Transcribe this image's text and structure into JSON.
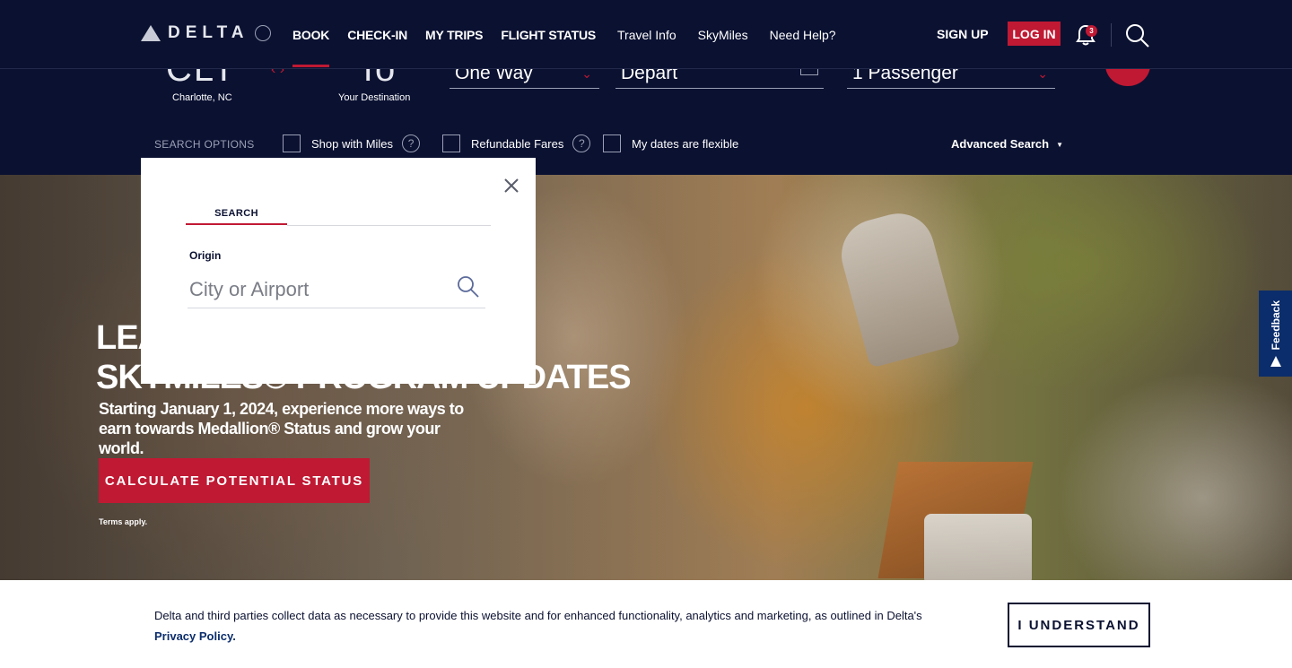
{
  "brand": {
    "name": "DELTA"
  },
  "nav": {
    "primary": [
      "BOOK",
      "CHECK-IN",
      "MY TRIPS",
      "FLIGHT STATUS"
    ],
    "secondary": [
      "Travel Info",
      "SkyMiles",
      "Need Help?"
    ],
    "sign_up": "SIGN UP",
    "log_in": "LOG IN",
    "notification_count": "3"
  },
  "booking": {
    "from_code": "CLT",
    "from_city": "Charlotte, NC",
    "to_code": "To",
    "to_label": "Your Destination",
    "trip_type": "One Way",
    "depart": "Depart",
    "passengers": "1 Passenger",
    "search_options_label": "SEARCH OPTIONS",
    "options": [
      "Shop with Miles",
      "Refundable Fares",
      "My dates are flexible"
    ],
    "advanced_search": "Advanced Search"
  },
  "hero": {
    "title_line1": "LEARN ABOUT",
    "title_line2": "SKYMILES® PROGRAM UPDATES",
    "subtitle": "Starting January 1, 2024, experience more ways to earn towards Medallion® Status and grow your world.",
    "cta": "CALCULATE POTENTIAL STATUS",
    "terms": "Terms apply."
  },
  "feedback": {
    "label": "Feedback"
  },
  "modal": {
    "tab": "SEARCH",
    "label": "Origin",
    "placeholder": "City or Airport"
  },
  "cookie": {
    "text": "Delta and third parties collect data as necessary to provide this website and for enhanced functionality, analytics and marketing, as outlined in Delta's ",
    "link": "Privacy Policy.",
    "button": "I UNDERSTAND"
  },
  "colors": {
    "navy": "#0b1131",
    "red": "#c01933"
  }
}
